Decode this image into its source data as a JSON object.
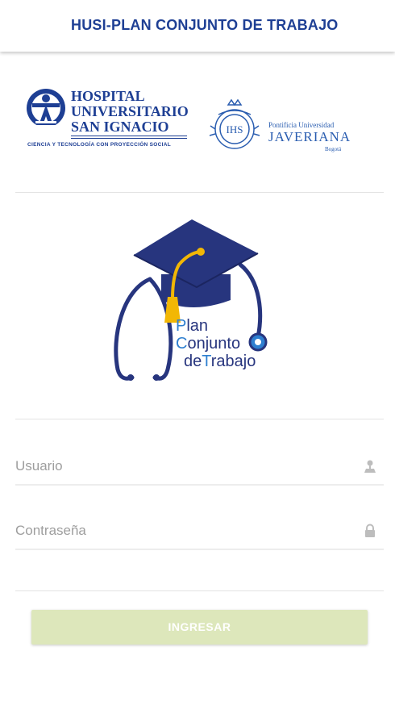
{
  "appbar": {
    "title": "HUSI-PLAN CONJUNTO DE TRABAJO"
  },
  "logos": {
    "husi": {
      "line1": "HOSPITAL",
      "line2": "UNIVERSITARIO",
      "line3": "SAN IGNACIO",
      "tagline": "CIENCIA Y TECNOLOGÍA CON PROYECCIÓN SOCIAL"
    },
    "javeriana": {
      "line1": "Pontificia Universidad",
      "line2": "JAVERIANA",
      "city": "Bogotá",
      "seal": "IHS"
    }
  },
  "app_logo": {
    "line1_first": "P",
    "line1_rest": "lan",
    "line2_first": "C",
    "line2_rest": "onjunto",
    "line3_a": "de",
    "line3_first": "T",
    "line3_rest": "rabajo"
  },
  "form": {
    "username_placeholder": "Usuario",
    "password_placeholder": "Contraseña",
    "submit_label": "INGRESAR"
  },
  "colors": {
    "brand_blue": "#1e3f94",
    "button_disabled": "#dde7bb",
    "cap_navy": "#27357e",
    "tassel_gold": "#f2b705"
  }
}
